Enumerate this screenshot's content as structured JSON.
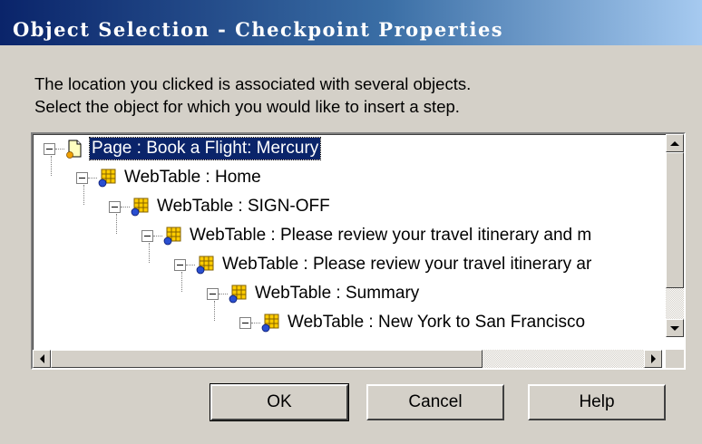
{
  "window": {
    "title": "Object Selection - Checkpoint Properties"
  },
  "instructions": {
    "line1": "The location you clicked is associated with several objects.",
    "line2": "Select the object for which you would like to insert a step."
  },
  "tree": {
    "items": [
      {
        "label": "Page : Book a Flight: Mercury",
        "icon": "page-icon",
        "selected": true
      },
      {
        "label": "WebTable : Home",
        "icon": "webtable-icon",
        "selected": false
      },
      {
        "label": "WebTable : SIGN-OFF",
        "icon": "webtable-icon",
        "selected": false
      },
      {
        "label": "WebTable : Please review your travel itinerary and m",
        "icon": "webtable-icon",
        "selected": false
      },
      {
        "label": "WebTable : Please review your travel itinerary ar",
        "icon": "webtable-icon",
        "selected": false
      },
      {
        "label": "WebTable : Summary",
        "icon": "webtable-icon",
        "selected": false
      },
      {
        "label": "WebTable : New York to San Francisco",
        "icon": "webtable-icon",
        "selected": false
      }
    ]
  },
  "buttons": {
    "ok": "OK",
    "cancel": "Cancel",
    "help": "Help"
  },
  "colors": {
    "title_gradient_start": "#0a246a",
    "title_gradient_end": "#a6caf0",
    "selection": "#0a246a",
    "dialog_bg": "#d4d0c8"
  }
}
